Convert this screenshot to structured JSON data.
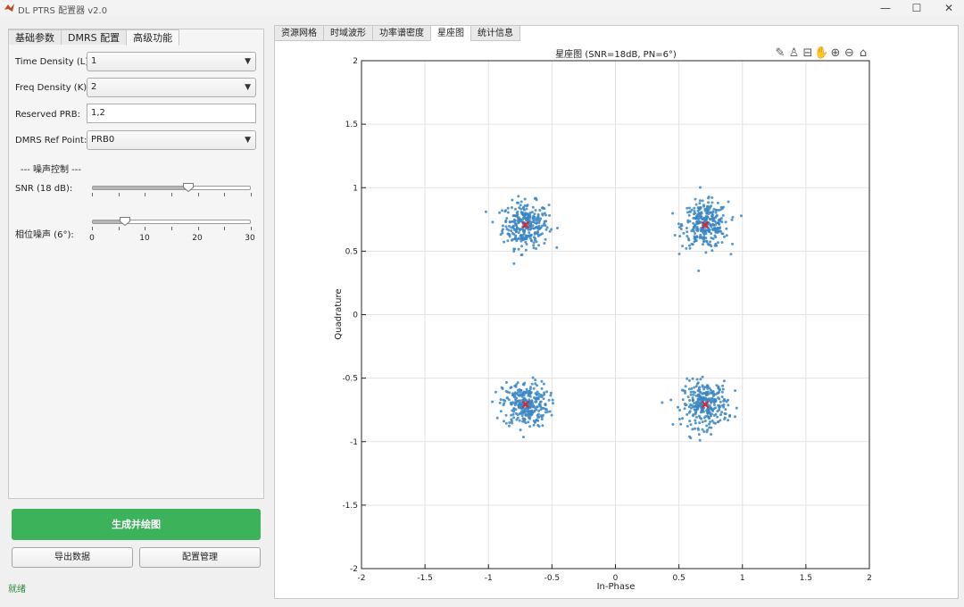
{
  "window": {
    "title": "DL PTRS 配置器 v2.0",
    "minimize": "—",
    "maximize": "☐",
    "close": "✕"
  },
  "left_tabs": [
    "基础参数",
    "DMRS 配置",
    "高级功能"
  ],
  "active_left_tab": 2,
  "form": {
    "time_density_label": "Time Density (L):",
    "time_density_value": "1",
    "freq_density_label": "Freq Density (K):",
    "freq_density_value": "2",
    "reserved_prb_label": "Reserved PRB:",
    "reserved_prb_value": "1,2",
    "dmrs_ref_label": "DMRS Ref Point:",
    "dmrs_ref_value": "PRB0",
    "noise_section": "--- 噪声控制 ---",
    "snr_label": "SNR (18 dB):",
    "snr_value": 18,
    "snr_max": 30,
    "phase_label": "相位噪声 (6°):",
    "phase_value": 6,
    "phase_max": 30,
    "phase_ticks": [
      "0",
      "10",
      "20",
      "30"
    ]
  },
  "buttons": {
    "generate": "生成并绘图",
    "export": "导出数据",
    "config": "配置管理"
  },
  "status": "就绪",
  "right_tabs": [
    "资源网格",
    "时域波形",
    "功率谱密度",
    "星座图",
    "统计信息"
  ],
  "active_right_tab": 3,
  "toolbar_icons": [
    "brush-icon",
    "data-tip-icon",
    "save-icon",
    "pan-icon",
    "zoom-in-icon",
    "zoom-out-icon",
    "home-icon"
  ],
  "accent_color": "#3cb25a",
  "chart_data": {
    "type": "scatter",
    "title": "星座图 (SNR=18dB, PN=6°)",
    "xlabel": "In-Phase",
    "ylabel": "Quadrature",
    "xlim": [
      -2,
      2
    ],
    "ylim": [
      -2,
      2
    ],
    "xticks": [
      "-2",
      "-1.5",
      "-1",
      "-0.5",
      "0",
      "0.5",
      "1",
      "1.5",
      "2"
    ],
    "yticks": [
      "-2",
      "-1.5",
      "-1",
      "-0.5",
      "0",
      "0.5",
      "1",
      "1.5",
      "2"
    ],
    "grid": true,
    "series": [
      {
        "marker": "dot",
        "color": "#3a86c4",
        "clusters": [
          {
            "center": [
              -0.707,
              0.707
            ],
            "spread": 0.09,
            "count": 300
          },
          {
            "center": [
              0.707,
              0.707
            ],
            "spread": 0.09,
            "count": 300
          },
          {
            "center": [
              -0.707,
              -0.707
            ],
            "spread": 0.09,
            "count": 300
          },
          {
            "center": [
              0.707,
              -0.707
            ],
            "spread": 0.09,
            "count": 300
          }
        ]
      },
      {
        "marker": "x",
        "color": "#d9252b",
        "points": [
          [
            -0.707,
            0.707
          ],
          [
            0.707,
            0.707
          ],
          [
            -0.707,
            -0.707
          ],
          [
            0.707,
            -0.707
          ]
        ]
      }
    ]
  }
}
